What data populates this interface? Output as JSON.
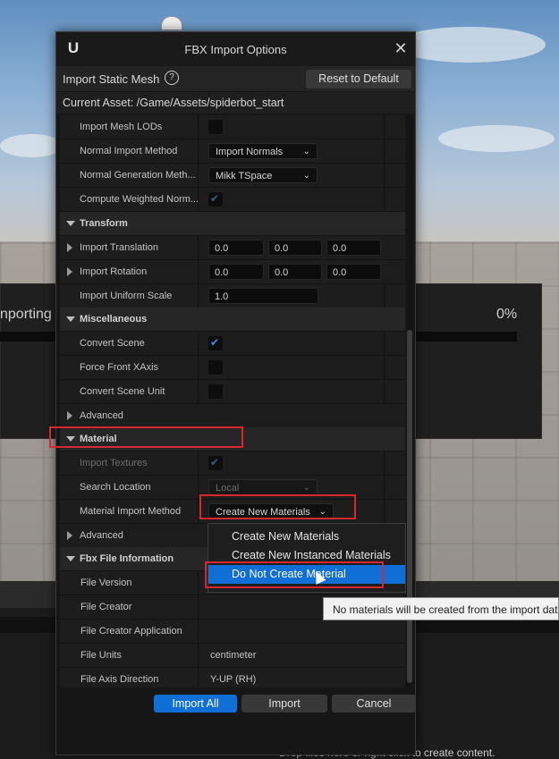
{
  "background": {
    "progress_text": "nporting",
    "progress_percent": "0%",
    "drop_hint": "Drop files here or right click to create content."
  },
  "dialog": {
    "title": "FBX Import Options",
    "header_title": "Import Static Mesh",
    "reset_label": "Reset to Default",
    "current_asset": "Current Asset:  /Game/Assets/spiderbot_start"
  },
  "rows": {
    "import_mesh_lods": "Import Mesh LODs",
    "normal_import_method": "Normal Import Method",
    "normal_import_value": "Import Normals",
    "normal_generation_method": "Normal Generation Meth...",
    "normal_generation_value": "Mikk TSpace",
    "compute_weighted": "Compute Weighted Norm...",
    "transform": "Transform",
    "import_translation": "Import Translation",
    "translation": [
      "0.0",
      "0.0",
      "0.0"
    ],
    "import_rotation": "Import Rotation",
    "rotation": [
      "0.0",
      "0.0",
      "0.0"
    ],
    "import_uniform_scale": "Import Uniform Scale",
    "uniform_scale": "1.0",
    "miscellaneous": "Miscellaneous",
    "convert_scene": "Convert Scene",
    "force_front_xaxis": "Force Front XAxis",
    "convert_scene_unit": "Convert Scene Unit",
    "advanced_1": "Advanced",
    "material": "Material",
    "import_textures": "Import Textures",
    "search_location": "Search Location",
    "search_location_value": "Local",
    "material_import_method": "Material Import Method",
    "material_import_value": "Create New Materials",
    "advanced_2": "Advanced",
    "fbx_file_information": "Fbx File Information",
    "file_version": "File Version",
    "file_creator": "File Creator",
    "file_creator_application": "File Creator Application",
    "file_units": "File Units",
    "file_units_value": "centimeter",
    "file_axis_direction": "File Axis Direction",
    "file_axis_value": "Y-UP (RH)"
  },
  "checkboxes": {
    "import_mesh_lods": false,
    "compute_weighted": true,
    "convert_scene": true,
    "force_front_xaxis": false,
    "convert_scene_unit": false,
    "import_textures": true
  },
  "footer": {
    "import_all": "Import All",
    "import": "Import",
    "cancel": "Cancel"
  },
  "menu": {
    "items": [
      "Create New Materials",
      "Create New Instanced Materials",
      "Do Not Create Material"
    ],
    "selected_index": 2
  },
  "tooltip": "No materials will be created from the import data",
  "colors": {
    "accent": "#0f6fd6",
    "highlight": "#d8262e",
    "checkbox_tick": "#4d8fe0"
  }
}
